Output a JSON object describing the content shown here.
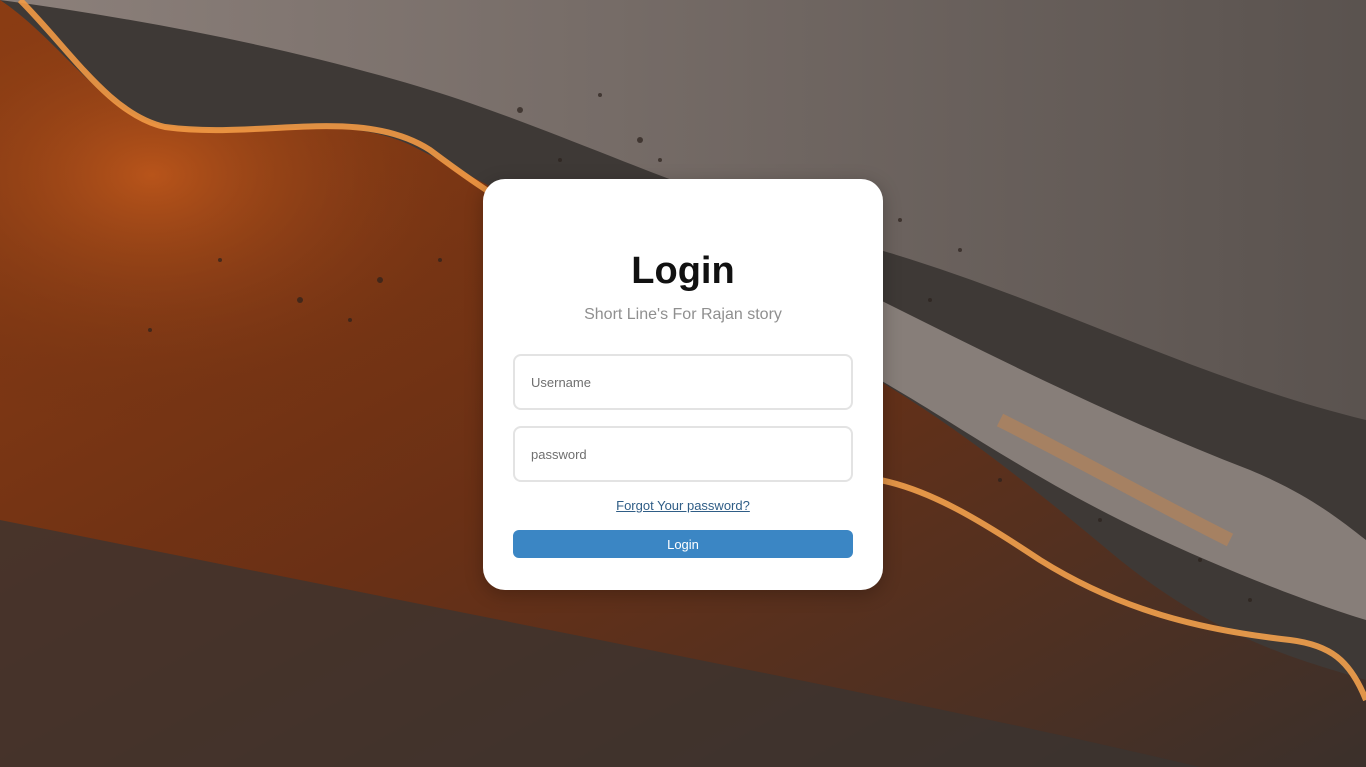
{
  "login_card": {
    "title": "Login",
    "subtitle": "Short Line's For Rajan story",
    "username_placeholder": "Username",
    "username_value": "",
    "password_placeholder": "password",
    "password_value": "",
    "forgot_link": "Forgot Your password?",
    "login_button": "Login"
  },
  "colors": {
    "button": "#3b86c4",
    "link": "#2f5d86",
    "card": "#ffffff",
    "background_dark": "#3d3835",
    "background_dune": "#c4621c"
  }
}
